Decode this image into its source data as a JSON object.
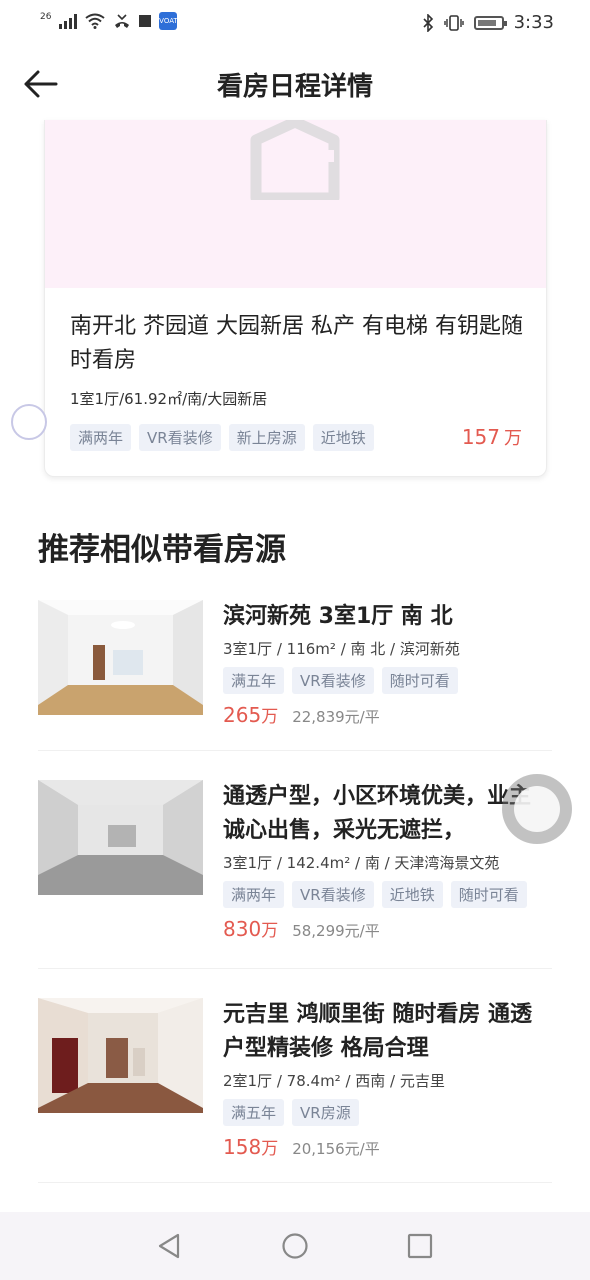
{
  "status_bar": {
    "network": "26",
    "time": "3:33",
    "app_icon_text": "VOAT"
  },
  "header": {
    "title": "看房日程详情"
  },
  "scheduled_listing": {
    "title": "南开北 芥园道 大园新居 私产 有电梯 有钥匙随时看房",
    "meta": "1室1厅/61.92㎡/南/大园新居",
    "tags": [
      "满两年",
      "VR看装修",
      "新上房源",
      "近地铁"
    ],
    "price_value": "157",
    "price_unit": "万"
  },
  "recommend": {
    "section_title": "推荐相似带看房源",
    "items": [
      {
        "title": "滨河新苑 3室1厅 南 北",
        "meta": "3室1厅 / 116m² / 南 北 / 滨河新苑",
        "tags": [
          "满五年",
          "VR看装修",
          "随时可看"
        ],
        "price_value": "265",
        "price_unit": "万",
        "unit_price": "22,839元/平"
      },
      {
        "title": "通透户型，小区环境优美，业主诚心出售，采光无遮拦，",
        "meta": "3室1厅 / 142.4m² / 南 / 天津湾海景文苑",
        "tags": [
          "满两年",
          "VR看装修",
          "近地铁",
          "随时可看"
        ],
        "price_value": "830",
        "price_unit": "万",
        "unit_price": "58,299元/平"
      },
      {
        "title": "元吉里 鸿顺里街 随时看房 通透户型精装修 格局合理",
        "meta": "2室1厅 / 78.4m² / 西南 / 元吉里",
        "tags": [
          "满五年",
          "VR房源"
        ],
        "price_value": "158",
        "price_unit": "万",
        "unit_price": "20,156元/平"
      }
    ]
  },
  "colors": {
    "price": "#e35a50",
    "tag_bg": "#eef1f8",
    "tag_text": "#7a8496",
    "cover_placeholder": "#fdf0f9"
  }
}
